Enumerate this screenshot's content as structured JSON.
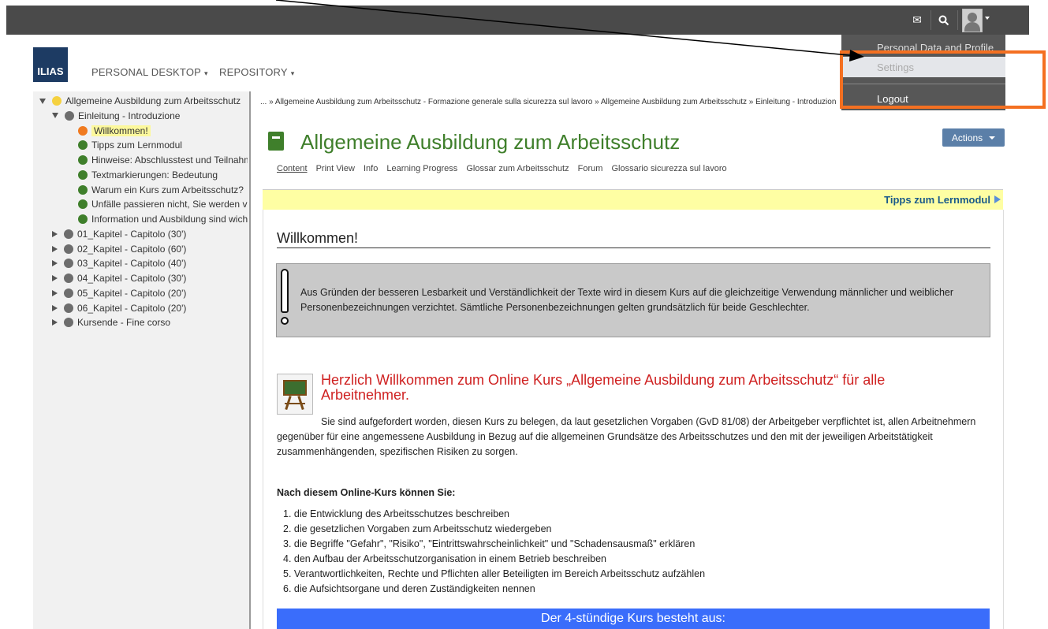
{
  "topbar": {
    "icons": [
      "mail-icon",
      "search-icon",
      "user-avatar-icon",
      "chevron-down-icon"
    ]
  },
  "header": {
    "logo": "ILIAS",
    "nav": [
      {
        "label": "PERSONAL DESKTOP",
        "caret": "▾"
      },
      {
        "label": "REPOSITORY",
        "caret": "▾"
      }
    ]
  },
  "user_menu": {
    "items": [
      "Personal Data and Profile",
      "Settings",
      "Logout"
    ]
  },
  "tree": {
    "items": [
      {
        "label": "Allgemeine Ausbildung zum Arbeitsschutz",
        "dot": "yellow",
        "toggle": "down"
      },
      {
        "label": "Einleitung - Introduzione",
        "dot": "grey",
        "toggle": "down"
      },
      {
        "label": "Willkommen!",
        "dot": "orange",
        "toggle": ""
      },
      {
        "label": "Tipps zum Lernmodul",
        "dot": "green",
        "toggle": ""
      },
      {
        "label": "Hinweise: Abschlusstest und Teilnahme",
        "dot": "green",
        "toggle": ""
      },
      {
        "label": "Textmarkierungen: Bedeutung",
        "dot": "green",
        "toggle": ""
      },
      {
        "label": "Warum ein Kurs zum Arbeitsschutz?",
        "dot": "green",
        "toggle": ""
      },
      {
        "label": "Unfälle passieren nicht, Sie werden verursacht",
        "dot": "green",
        "toggle": ""
      },
      {
        "label": "Information und Ausbildung sind wichtig",
        "dot": "green",
        "toggle": ""
      },
      {
        "label": "01_Kapitel - Capitolo (30')",
        "dot": "grey",
        "toggle": "right"
      },
      {
        "label": "02_Kapitel - Capitolo (60')",
        "dot": "grey",
        "toggle": "right"
      },
      {
        "label": "03_Kapitel - Capitolo (40')",
        "dot": "grey",
        "toggle": "right"
      },
      {
        "label": "04_Kapitel - Capitolo (30')",
        "dot": "grey",
        "toggle": "right"
      },
      {
        "label": "05_Kapitel - Capitolo (20')",
        "dot": "grey",
        "toggle": "right"
      },
      {
        "label": "06_Kapitel - Capitolo (20')",
        "dot": "grey",
        "toggle": "right"
      },
      {
        "label": "Kursende - Fine corso",
        "dot": "grey",
        "toggle": "right"
      }
    ]
  },
  "breadcrumb": "... » Allgemeine Ausbildung zum Arbeitsschutz - Formazione generale sulla sicurezza sul lavoro » Allgemeine Ausbildung zum Arbeitsschutz » Einleitung - Introduzione",
  "page": {
    "title": "Allgemeine Ausbildung zum Arbeitsschutz",
    "actions_label": "Actions",
    "tabs": [
      "Content",
      "Print View",
      "Info",
      "Learning Progress",
      "Glossar zum Arbeitsschutz",
      "Forum",
      "Glossario sicurezza sul lavoro"
    ],
    "next_link": "Tipps zum Lernmodul"
  },
  "content": {
    "section_title": "Willkommen!",
    "note": "Aus Gründen der besseren Lesbarkeit und Verständlichkeit der Texte wird in diesem Kurs auf die gleichzeitige Verwendung männlicher und weiblicher Personenbezeichnungen verzichtet. Sämtliche Personenbezeichnungen gelten grundsätzlich für beide Geschlechter.",
    "welcome_heading": "Herzlich Willkommen zum Online Kurs „Allgemeine Ausbildung zum Arbeitsschutz“ für alle Arbeitnehmer.",
    "welcome_body": "Sie sind aufgefordert worden, diesen Kurs zu belegen, da laut gesetzlichen Vorgaben (GvD 81/08) der Arbeitgeber verpflichtet ist, allen Arbeitnehmern gegenüber für eine angemessene Ausbildung in Bezug auf die allgemeinen Grundsätze des Arbeitsschutzes und den mit der jeweiligen Arbeitstätigkeit zusammenhängenden, spezifischen Risiken zu sorgen.",
    "list_heading": "Nach diesem Online-Kurs können Sie:",
    "list": [
      "1. die Entwicklung des Arbeitsschutzes beschreiben",
      "2. die gesetzlichen Vorgaben zum Arbeitsschutz wiedergeben",
      "3. die Begriffe \"Gefahr\", \"Risiko\", \"Eintrittswahrscheinlichkeit\" und \"Schadensausmaß\" erklären",
      "4. den Aufbau der Arbeitsschutzorganisation in einem Betrieb beschreiben",
      "5. Verantwortlichkeiten, Rechte und Pflichten aller Beteiligten im Bereich Arbeitsschutz aufzählen",
      "6. die Aufsichtsorgane und deren Zuständigkeiten nennen"
    ],
    "blue_bar": "Der 4-stündige Kurs besteht aus:"
  },
  "colors": {
    "accent_green": "#3f7f2b",
    "highlight_orange": "#f47021",
    "topbar": "#4a4a4a",
    "blue_bar": "#3a6dfb"
  }
}
